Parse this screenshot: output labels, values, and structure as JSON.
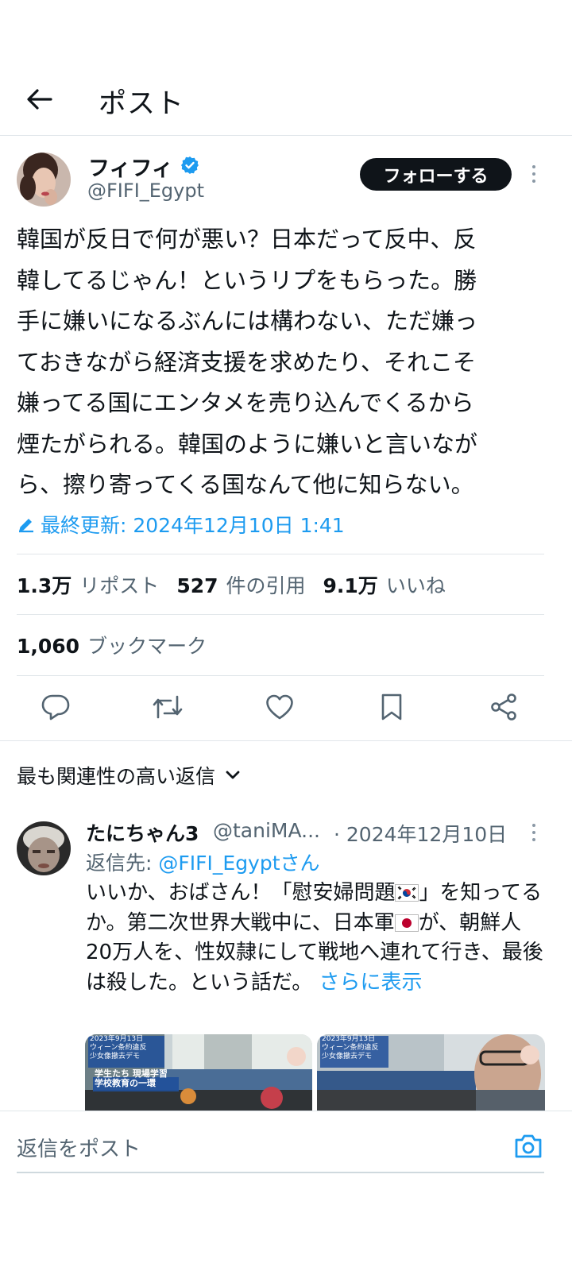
{
  "header": {
    "title": "ポスト",
    "back_icon": "arrow-left-icon"
  },
  "author": {
    "name": "フィフィ",
    "handle": "@FIFI_Egypt",
    "verified": true,
    "follow_label": "フォローする"
  },
  "tweet": {
    "text": "韓国が反日で何が悪い？日本だって反中、反\n韓してるじゃん！というリプをもらった。勝\n手に嫌いになるぶんには構わない、ただ嫌っ\nておきながら経済支援を求めたり、それこそ\n嫌ってる国にエンタメを売り込んでくるから\n煙たがられる。韓国のように嫌いと言いなが\nら、擦り寄ってくる国なんて他に知らない。",
    "edited_label": "最終更新: 2024年12月10日 1:41"
  },
  "stats": {
    "reposts_count": "1.3万",
    "reposts_label": "リポスト",
    "quotes_count": "527",
    "quotes_label": "件の引用",
    "likes_count": "9.1万",
    "likes_label": "いいね",
    "bookmarks_count": "1,060",
    "bookmarks_label": "ブックマーク"
  },
  "actions": [
    "reply-icon",
    "retweet-icon",
    "heart-icon",
    "bookmark-icon",
    "share-icon"
  ],
  "replies_filter": {
    "label": "最も関連性の高い返信"
  },
  "reply": {
    "name": "たにちゃん3",
    "handle": "@taniMA...",
    "date": "· 2024年12月10日",
    "reply_to_prefix": "返信先:",
    "reply_to_handle": "@FIFI_Egyptさん",
    "text_part1": "いいか、おばさん！「慰安婦問題",
    "text_part2": "」を知ってるか。第二次世界大戦中に、日本軍",
    "text_part3": "が、朝鮮人20万人を、性奴隷にして戦地へ連れて行き、最後は殺した。という話だ。",
    "show_more": "さらに表示",
    "media": [
      {
        "caption_lines": [
          "2023年9月13日",
          "ウィーン条約違反",
          "少女像撤去デモ"
        ],
        "overlay": "学生たち 現場学習",
        "overlay2": "学校教育の一環"
      },
      {
        "caption_lines": [
          "2023年9月13日",
          "ウィーン条約違反",
          "少女像撤去デモ"
        ]
      }
    ]
  },
  "composer": {
    "placeholder": "返信をポスト",
    "camera_icon": "camera-icon"
  },
  "colors": {
    "accent": "#1d9bf0",
    "text": "#0f1419",
    "muted": "#536471",
    "divider": "#e1e6ea"
  }
}
